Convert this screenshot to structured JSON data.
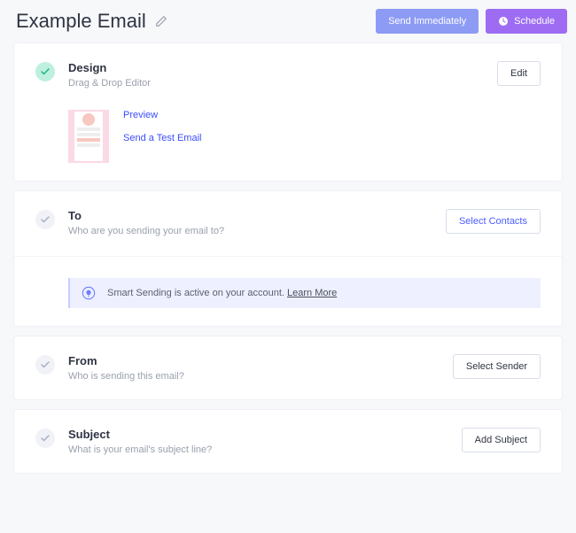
{
  "header": {
    "title": "Example Email",
    "send_btn": "Send Immediately",
    "schedule_btn": "Schedule"
  },
  "sections": {
    "design": {
      "title": "Design",
      "subtitle": "Drag & Drop Editor",
      "edit_btn": "Edit",
      "preview_link": "Preview",
      "test_link": "Send a Test Email"
    },
    "to": {
      "title": "To",
      "subtitle": "Who are you sending your email to?",
      "action_btn": "Select Contacts",
      "banner_prefix": "Smart Sending is active on your account. ",
      "banner_link": "Learn More"
    },
    "from": {
      "title": "From",
      "subtitle": "Who is sending this email?",
      "action_btn": "Select Sender"
    },
    "subject": {
      "title": "Subject",
      "subtitle": "What is your email's subject line?",
      "action_btn": "Add Subject"
    }
  }
}
